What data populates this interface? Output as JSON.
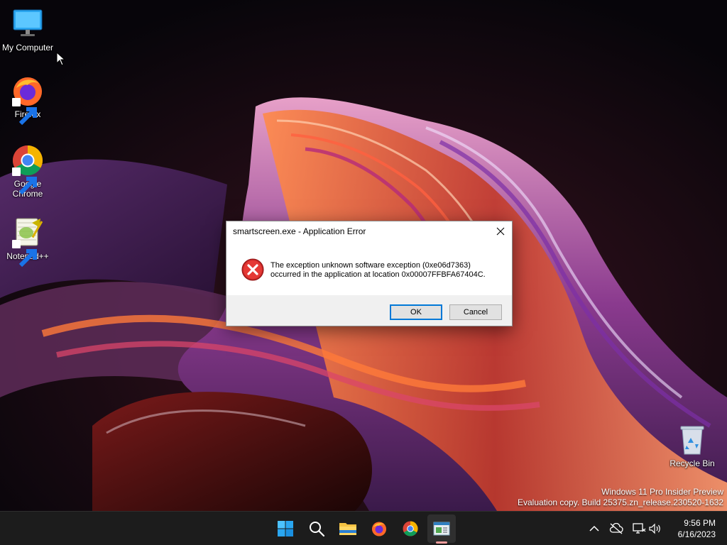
{
  "desktop": {
    "icons": [
      {
        "label": "My Computer",
        "icon": "monitor-icon"
      },
      {
        "label": "Firefox",
        "icon": "firefox-icon"
      },
      {
        "label": "Google Chrome",
        "icon": "chrome-icon"
      },
      {
        "label": "Notepad++",
        "icon": "notepadpp-icon"
      },
      {
        "label": "Recycle Bin",
        "icon": "recycle-bin-icon"
      }
    ],
    "watermark": {
      "line1": "Windows 11 Pro Insider Preview",
      "line2": "Evaluation copy. Build 25375.zn_release.230520-1632"
    }
  },
  "dialog": {
    "title": "smartscreen.exe - Application Error",
    "message_line1": "The exception unknown software exception (0xe06d7363)",
    "message_line2": "occurred in the application at location 0x00007FFBFA67404C.",
    "ok_label": "OK",
    "cancel_label": "Cancel",
    "icon": "error-icon"
  },
  "taskbar": {
    "items": [
      {
        "name": "start",
        "icon": "windows-start-icon"
      },
      {
        "name": "search",
        "icon": "search-icon"
      },
      {
        "name": "file-explorer",
        "icon": "folder-icon"
      },
      {
        "name": "firefox",
        "icon": "firefox-icon"
      },
      {
        "name": "chrome",
        "icon": "chrome-icon"
      },
      {
        "name": "active-app",
        "icon": "app-window-icon"
      }
    ],
    "tray": {
      "icons": [
        "chevron-up-icon",
        "cloud-offline-icon",
        "network-icon",
        "volume-icon"
      ]
    },
    "clock": {
      "time": "9:56 PM",
      "date": "6/16/2023"
    }
  },
  "colors": {
    "taskbar_bg": "#1c1c1c",
    "dialog_footer": "#f0f0f0",
    "button_focus": "#0078d7",
    "error_red": "#d32f2f"
  }
}
